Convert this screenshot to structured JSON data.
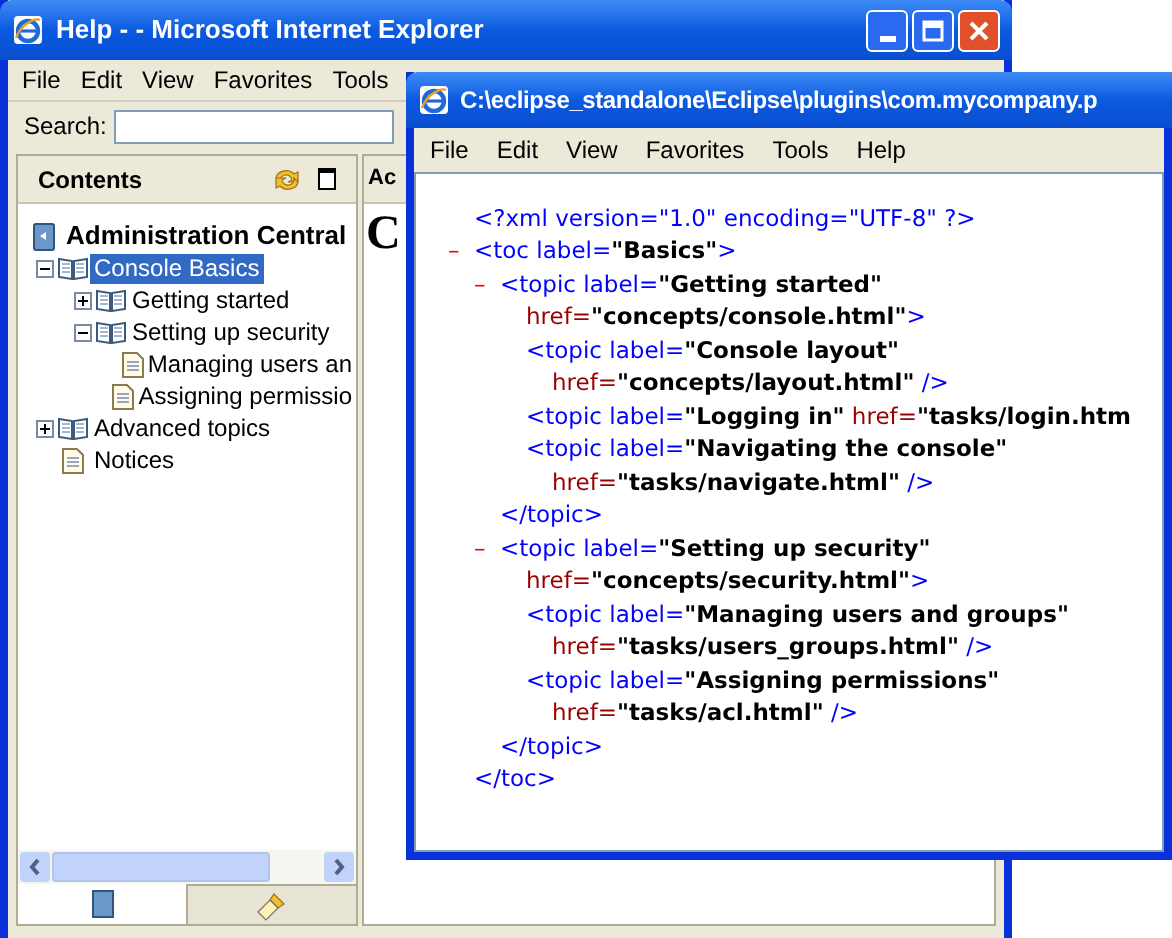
{
  "ie_window": {
    "title": "Help - - Microsoft Internet Explorer",
    "menu": [
      "File",
      "Edit",
      "View",
      "Favorites",
      "Tools"
    ],
    "search": {
      "label": "Search:"
    },
    "contents_panel": {
      "title": "Contents",
      "tree": {
        "label": "Administration Central",
        "children": [
          {
            "kind": "book",
            "label": "Console Basics",
            "expanded": true,
            "selected": true,
            "children": [
              {
                "kind": "book",
                "label": "Getting started",
                "expanded": false,
                "selected": false
              },
              {
                "kind": "book",
                "label": "Setting up security",
                "expanded": true,
                "selected": false,
                "children": [
                  {
                    "kind": "page",
                    "label": "Managing users an",
                    "selected": false
                  },
                  {
                    "kind": "page",
                    "label": "Assigning permissio",
                    "selected": false
                  }
                ]
              }
            ]
          },
          {
            "kind": "book",
            "label": "Advanced topics",
            "expanded": false,
            "selected": false
          },
          {
            "kind": "page",
            "label": "Notices",
            "selected": false
          }
        ]
      },
      "tabs": [
        {
          "kind": "contents",
          "selected": true
        },
        {
          "kind": "search",
          "selected": false
        }
      ]
    },
    "content_panel": {
      "title": "Ac",
      "heading": "C"
    }
  },
  "xml_window": {
    "title": "C:\\eclipse_standalone\\Eclipse\\plugins\\com.mycompany.p",
    "menu": [
      "File",
      "Edit",
      "View",
      "Favorites",
      "Tools",
      "Help"
    ],
    "declaration": [
      {
        "kind": "tag",
        "text": "<?xml version=\"1.0\" encoding=\"UTF-8\" ?>"
      }
    ],
    "root": {
      "toggle": "–",
      "open": [
        [
          {
            "kind": "tag",
            "text": "<toc label="
          },
          {
            "kind": "value",
            "text": "\"Basics\""
          },
          {
            "kind": "tag",
            "text": ">"
          }
        ]
      ],
      "children": [
        {
          "toggle": "–",
          "open": [
            [
              {
                "kind": "tag",
                "text": "<topic label="
              },
              {
                "kind": "value",
                "text": "\"Getting started\""
              }
            ],
            [
              {
                "kind": "attr",
                "text": "href="
              },
              {
                "kind": "value",
                "text": "\"concepts/console.html\""
              },
              {
                "kind": "tag",
                "text": ">"
              }
            ]
          ],
          "children": [
            {
              "open": [
                [
                  {
                    "kind": "tag",
                    "text": "<topic label="
                  },
                  {
                    "kind": "value",
                    "text": "\"Console layout\""
                  }
                ],
                [
                  {
                    "kind": "attr",
                    "text": "href="
                  },
                  {
                    "kind": "value",
                    "text": "\"concepts/layout.html\""
                  },
                  {
                    "kind": "tag",
                    "text": " />"
                  }
                ]
              ]
            },
            {
              "open": [
                [
                  {
                    "kind": "tag",
                    "text": "<topic label="
                  },
                  {
                    "kind": "value",
                    "text": "\"Logging in\""
                  },
                  {
                    "kind": "attr",
                    "text": " href="
                  },
                  {
                    "kind": "value",
                    "text": "\"tasks/login.htm"
                  }
                ]
              ]
            },
            {
              "open": [
                [
                  {
                    "kind": "tag",
                    "text": "<topic label="
                  },
                  {
                    "kind": "value",
                    "text": "\"Navigating the console\""
                  }
                ],
                [
                  {
                    "kind": "attr",
                    "text": "href="
                  },
                  {
                    "kind": "value",
                    "text": "\"tasks/navigate.html\""
                  },
                  {
                    "kind": "tag",
                    "text": " />"
                  }
                ]
              ]
            }
          ],
          "close": [
            {
              "kind": "tag",
              "text": "</topic>"
            }
          ]
        },
        {
          "toggle": "–",
          "open": [
            [
              {
                "kind": "tag",
                "text": "<topic label="
              },
              {
                "kind": "value",
                "text": "\"Setting up security\""
              }
            ],
            [
              {
                "kind": "attr",
                "text": "href="
              },
              {
                "kind": "value",
                "text": "\"concepts/security.html\""
              },
              {
                "kind": "tag",
                "text": ">"
              }
            ]
          ],
          "children": [
            {
              "open": [
                [
                  {
                    "kind": "tag",
                    "text": "<topic label="
                  },
                  {
                    "kind": "value",
                    "text": "\"Managing users and groups\""
                  }
                ],
                [
                  {
                    "kind": "attr",
                    "text": "href="
                  },
                  {
                    "kind": "value",
                    "text": "\"tasks/users_groups.html\""
                  },
                  {
                    "kind": "tag",
                    "text": " />"
                  }
                ]
              ]
            },
            {
              "open": [
                [
                  {
                    "kind": "tag",
                    "text": "<topic label="
                  },
                  {
                    "kind": "value",
                    "text": "\"Assigning permissions\""
                  }
                ],
                [
                  {
                    "kind": "attr",
                    "text": "href="
                  },
                  {
                    "kind": "value",
                    "text": "\"tasks/acl.html\""
                  },
                  {
                    "kind": "tag",
                    "text": " />"
                  }
                ]
              ]
            }
          ],
          "close": [
            {
              "kind": "tag",
              "text": "</topic>"
            }
          ]
        }
      ],
      "close": [
        {
          "kind": "tag",
          "text": "</toc>"
        }
      ]
    }
  }
}
